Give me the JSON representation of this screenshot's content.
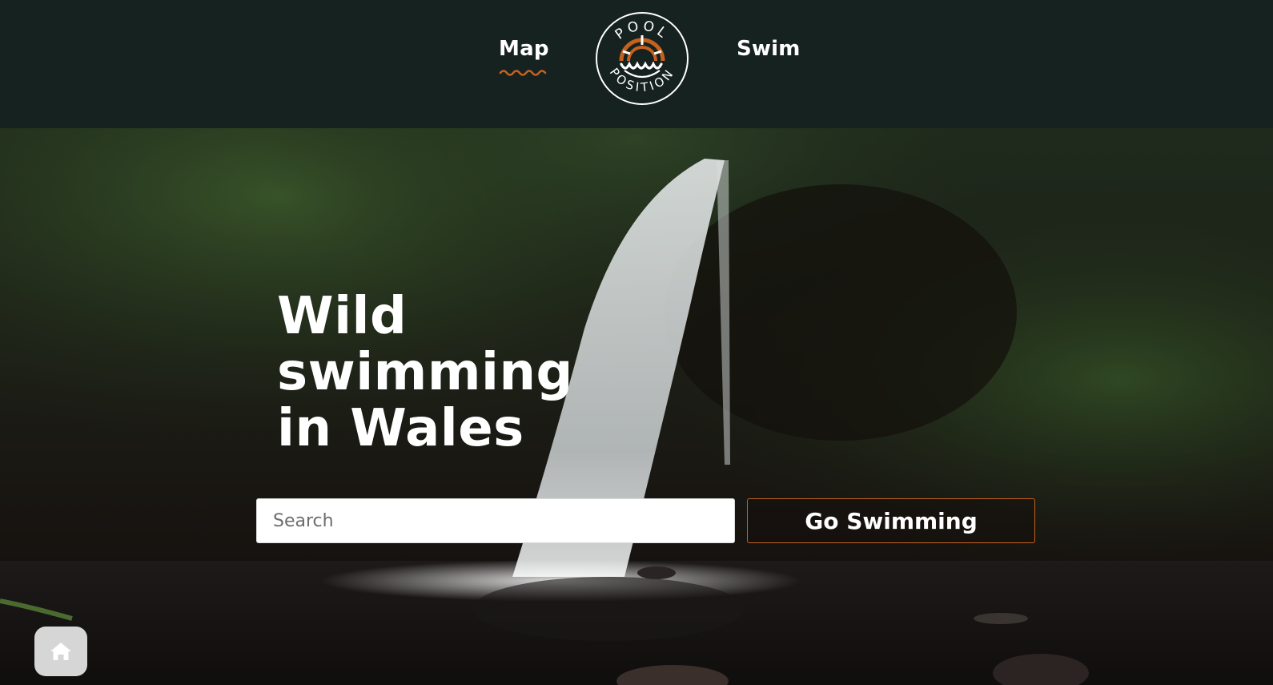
{
  "header": {
    "nav": {
      "map_label": "Map",
      "swim_label": "Swim"
    },
    "logo": {
      "text_top": "POOL",
      "text_bottom": "POSITION",
      "icon": "pool-position-logo-icon"
    }
  },
  "hero": {
    "title": "Wild swimming in Wales",
    "search": {
      "placeholder": "Search",
      "value": ""
    },
    "cta_label": "Go Swimming",
    "background": "waterfall-forest-photo"
  },
  "floating": {
    "home_icon": "home-icon"
  },
  "colors": {
    "header_bg": "#162220",
    "accent": "#c5611f",
    "text": "#ffffff",
    "home_button_bg": "#d6d6d6"
  }
}
